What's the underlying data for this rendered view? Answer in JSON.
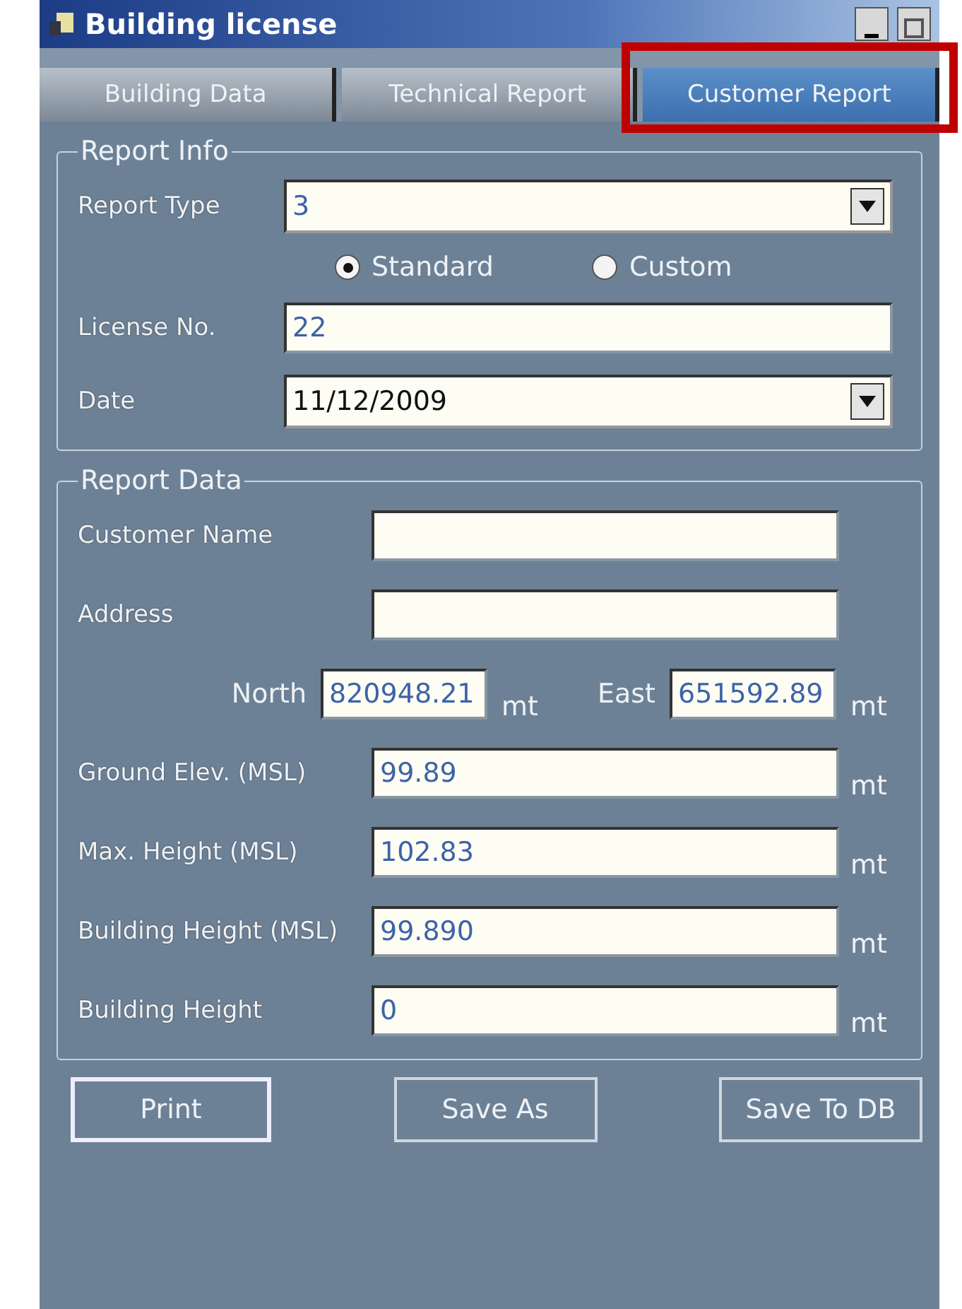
{
  "window": {
    "title": "Building license"
  },
  "tabs": [
    {
      "label": "Building Data",
      "selected": false
    },
    {
      "label": "Technical Report",
      "selected": false
    },
    {
      "label": "Customer Report",
      "selected": true
    }
  ],
  "report_info": {
    "title": "Report Info",
    "report_type": {
      "label": "Report Type",
      "value": "3"
    },
    "radios": [
      {
        "label": "Standard",
        "selected": true
      },
      {
        "label": "Custom",
        "selected": false
      }
    ],
    "license_no": {
      "label": "License No.",
      "value": "22"
    },
    "date": {
      "label": "Date",
      "value": "11/12/2009"
    }
  },
  "report_data": {
    "title": "Report Data",
    "items": [
      {
        "kind": "field",
        "label": "Customer Name"
      },
      {
        "kind": "field",
        "label": "Address"
      },
      {
        "kind": "pair",
        "fields": [
          {
            "label": "North",
            "value": "820948.21",
            "unit": "mt"
          },
          {
            "label": "East",
            "value": "651592.89",
            "unit": "mt"
          }
        ]
      },
      {
        "kind": "field",
        "label": "Ground Elev. (MSL)",
        "value": "99.89",
        "unit": "mt"
      },
      {
        "kind": "field",
        "label": "Max. Height (MSL)",
        "value": "102.83",
        "unit": "mt"
      },
      {
        "kind": "field",
        "label": "Building Height (MSL)",
        "value": "99.890",
        "unit": "mt"
      },
      {
        "kind": "field",
        "label": "Building Height",
        "value": "0",
        "unit": "mt"
      }
    ]
  },
  "buttons": [
    "Print",
    "Save As",
    "Save To DB"
  ]
}
